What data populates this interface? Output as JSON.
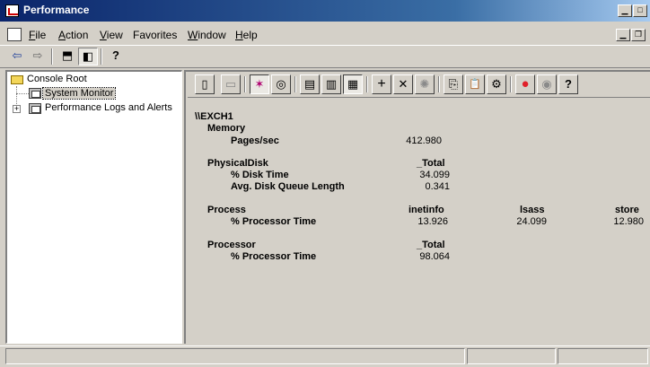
{
  "window": {
    "title": "Performance"
  },
  "caption_buttons": [
    "minimize",
    "maximize"
  ],
  "menu": [
    {
      "label": "File",
      "accel": "F",
      "rest": "ile"
    },
    {
      "label": "Action",
      "accel": "A",
      "rest": "ction"
    },
    {
      "label": "View",
      "accel": "V",
      "rest": "iew"
    },
    {
      "label": "Favorites",
      "accel": "",
      "rest": "Favorites"
    },
    {
      "label": "Window",
      "accel": "W",
      "rest": "indow"
    },
    {
      "label": "Help",
      "accel": "H",
      "rest": "elp"
    }
  ],
  "toolbar": {
    "back": "⇦",
    "forward": "⇨",
    "up": "⬒",
    "show_hide_tree": "◧",
    "help": "?"
  },
  "tree": {
    "root": "Console Root",
    "items": [
      {
        "label": "System Monitor",
        "selected": true
      },
      {
        "label": "Performance Logs and Alerts",
        "expander": "+"
      }
    ]
  },
  "sysmon_toolbar": [
    {
      "name": "new-counter-set",
      "glyph": "▯"
    },
    {
      "name": "clear-display",
      "glyph": "▭"
    },
    {
      "name": "view-current-activity",
      "glyph": "✶",
      "pressed": true
    },
    {
      "name": "view-log-data",
      "glyph": "◎"
    },
    {
      "name": "view-graph",
      "glyph": "▤"
    },
    {
      "name": "view-histogram",
      "glyph": "▥"
    },
    {
      "name": "view-report",
      "glyph": "▦",
      "pressed": true
    },
    {
      "name": "add-counter",
      "glyph": "+"
    },
    {
      "name": "delete-counter",
      "glyph": "✕"
    },
    {
      "name": "highlight",
      "glyph": "✺",
      "disabled": true
    },
    {
      "name": "copy-properties",
      "glyph": "⎘"
    },
    {
      "name": "paste-counter-list",
      "glyph": "📋"
    },
    {
      "name": "properties",
      "glyph": "⚙"
    },
    {
      "name": "freeze-display",
      "glyph": "●"
    },
    {
      "name": "update-data",
      "glyph": "◉",
      "disabled": true
    },
    {
      "name": "help",
      "glyph": "?"
    }
  ],
  "report": {
    "computer": "\\\\EXCH1",
    "objects": [
      {
        "name": "Memory",
        "instances": [],
        "counters": [
          {
            "name": "Pages/sec",
            "values": [
              "412.980"
            ]
          }
        ]
      },
      {
        "name": "PhysicalDisk",
        "instances": [
          "_Total"
        ],
        "counters": [
          {
            "name": "% Disk Time",
            "values": [
              "34.099"
            ]
          },
          {
            "name": "Avg. Disk Queue Length",
            "values": [
              "0.341"
            ]
          }
        ]
      },
      {
        "name": "Process",
        "instances": [
          "inetinfo",
          "lsass",
          "store"
        ],
        "counters": [
          {
            "name": "% Processor Time",
            "values": [
              "13.926",
              "24.099",
              "12.980"
            ]
          }
        ]
      },
      {
        "name": "Processor",
        "instances": [
          "_Total"
        ],
        "counters": [
          {
            "name": "% Processor Time",
            "values": [
              "98.064"
            ]
          }
        ]
      }
    ]
  },
  "colors": {
    "title_start": "#0a246a",
    "title_end": "#a6caf0",
    "face": "#d4d0c8",
    "freeze_red": "#e0202a"
  }
}
